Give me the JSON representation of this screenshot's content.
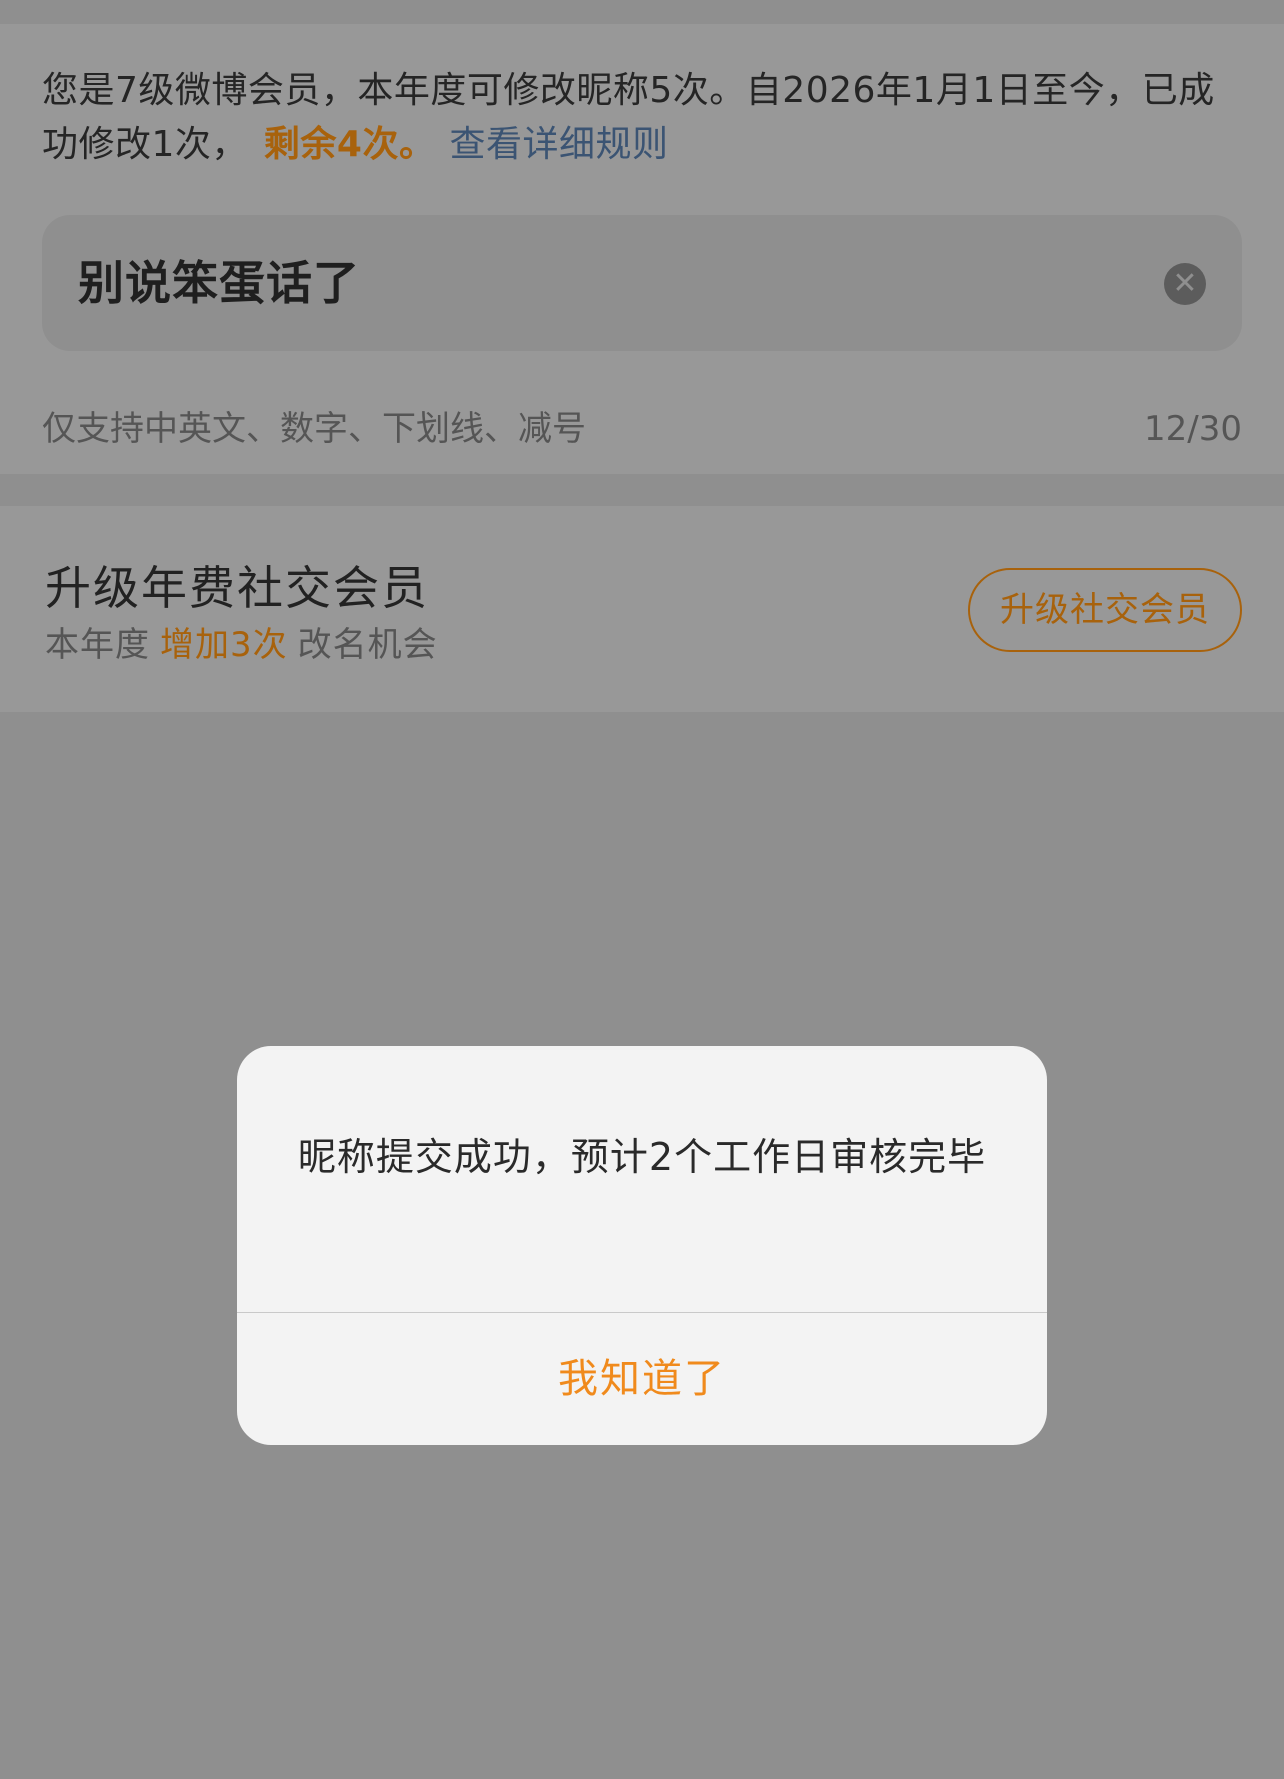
{
  "info": {
    "text_prefix": "您是7级微博会员，本年度可修改昵称5次。自2026年1月1日至今，已成功修改1次，",
    "remaining": "剩余4次。",
    "rules_link": "查看详细规则"
  },
  "nickname_input": {
    "value": "别说笨蛋话了",
    "clear_icon": "close-circle-icon"
  },
  "hint": {
    "text": "仅支持中英文、数字、下划线、减号",
    "count": "12/30"
  },
  "upgrade": {
    "title": "升级年费社交会员",
    "sub_prefix": "本年度",
    "sub_highlight": "增加3次",
    "sub_suffix": "改名机会",
    "button_label": "升级社交会员"
  },
  "dialog": {
    "message": "昵称提交成功，预计2个工作日审核完毕",
    "confirm_label": "我知道了"
  },
  "colors": {
    "accent": "#f08a1c",
    "accent_dimmed": "#a8620c",
    "link_dimmed": "#3b5473",
    "overlay": "#8f8f8f",
    "dialog_bg": "#f3f3f3"
  }
}
